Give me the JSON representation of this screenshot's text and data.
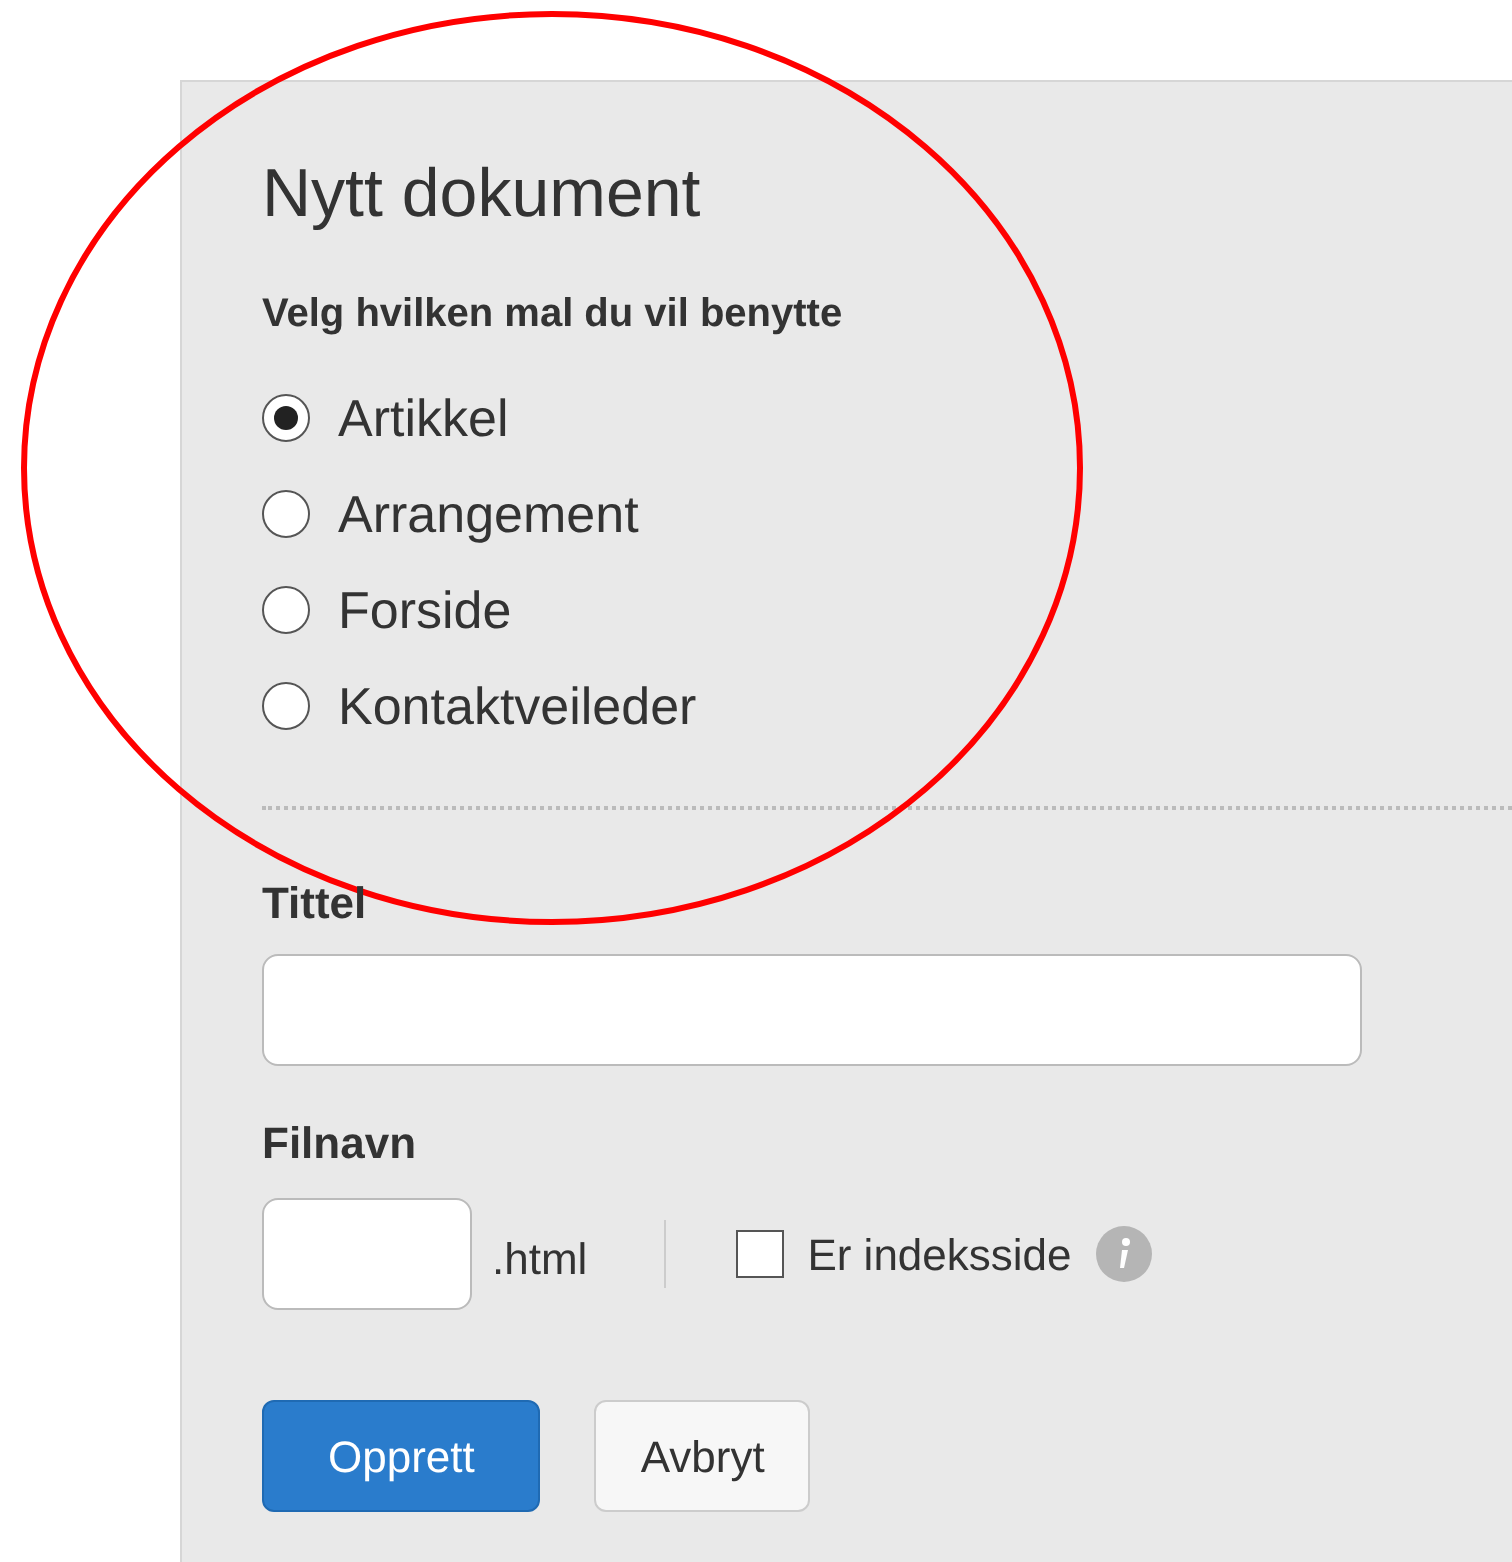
{
  "title": "Nytt dokument",
  "template_prompt": "Velg hvilken mal du vil benytte",
  "templates": [
    {
      "label": "Artikkel",
      "selected": true
    },
    {
      "label": "Arrangement",
      "selected": false
    },
    {
      "label": "Forside",
      "selected": false
    },
    {
      "label": "Kontaktveileder",
      "selected": false
    }
  ],
  "title_field": {
    "label": "Tittel"
  },
  "filename_field": {
    "label": "Filnavn",
    "suffix": ".html"
  },
  "index_checkbox": {
    "label": "Er indeksside",
    "checked": false
  },
  "buttons": [
    {
      "label": "Opprett",
      "kind": "primary"
    },
    {
      "label": "Avbryt",
      "kind": "secondary"
    }
  ],
  "annotation": {
    "kind": "ellipse",
    "color": "#ff0000"
  }
}
